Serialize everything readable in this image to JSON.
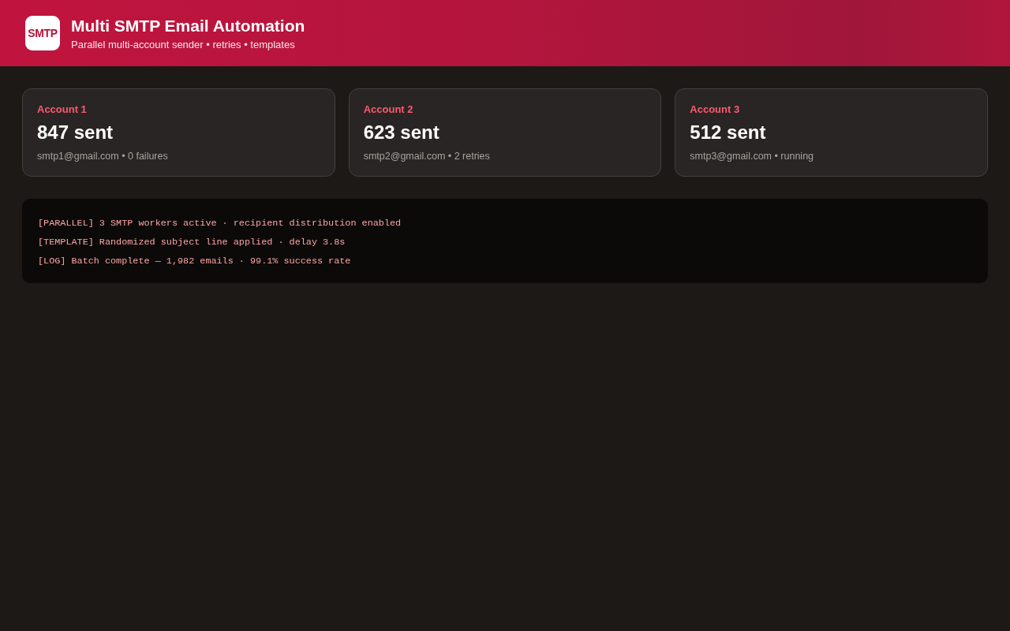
{
  "header": {
    "logo_text": "SMTP",
    "title": "Multi SMTP Email Automation",
    "subtitle": "Parallel multi-account sender • retries • templates"
  },
  "accounts": [
    {
      "label": "Account 1",
      "sent": "847 sent",
      "detail": "smtp1@gmail.com • 0 failures"
    },
    {
      "label": "Account 2",
      "sent": "623 sent",
      "detail": "smtp2@gmail.com • 2 retries"
    },
    {
      "label": "Account 3",
      "sent": "512 sent",
      "detail": "smtp3@gmail.com • running"
    }
  ],
  "log": {
    "lines": [
      "[PARALLEL] 3 SMTP workers active · recipient distribution enabled",
      "[TEMPLATE] Randomized subject line applied · delay 3.8s",
      "[LOG] Batch complete — 1,982 emails · 99.1% success rate"
    ]
  }
}
